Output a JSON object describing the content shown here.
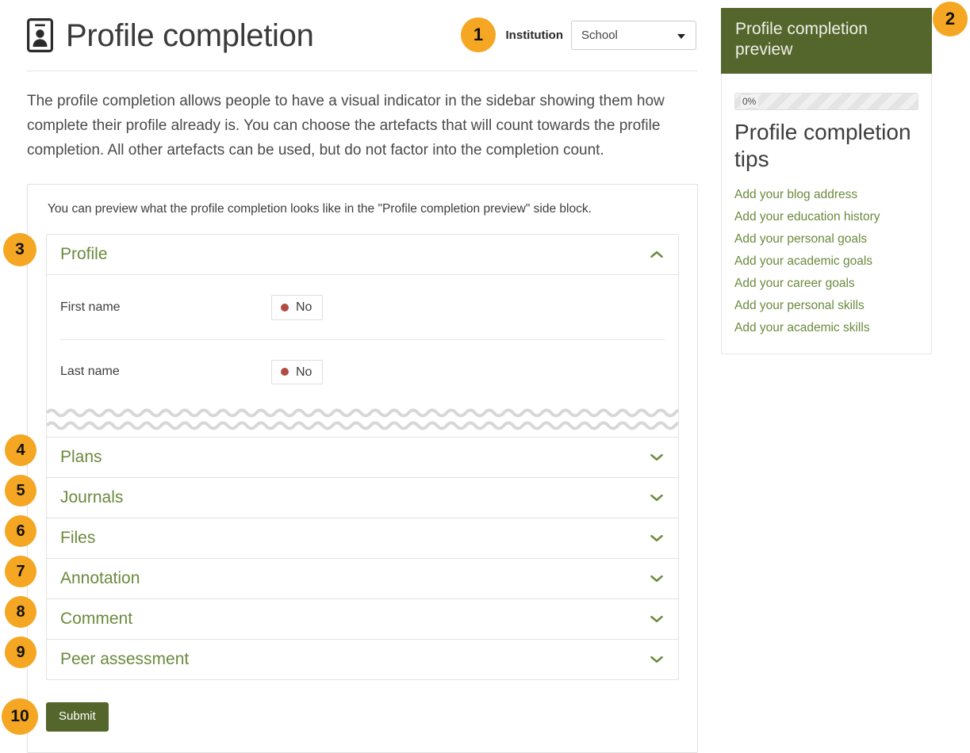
{
  "header": {
    "title": "Profile completion",
    "icon": "id-card-icon",
    "institution_label": "Institution",
    "institution_value": "School",
    "institution_options": [
      "School"
    ]
  },
  "intro": {
    "text": "The profile completion allows people to have a visual indicator in the sidebar showing them how complete their profile already is. You can choose the artefacts that will count towards the profile completion. All other artefacts can be used, but do not factor into the completion count."
  },
  "card": {
    "note": "You can preview what the profile completion looks like in the \"Profile completion preview\" side block.",
    "submit_label": "Submit"
  },
  "accordion": {
    "sections": [
      {
        "label": "Profile",
        "expanded": true,
        "chevron": "chevron-up-icon",
        "fields": [
          {
            "label": "First name",
            "value": "No",
            "state_color": "#b04b45"
          },
          {
            "label": "Last name",
            "value": "No",
            "state_color": "#b04b45"
          }
        ]
      },
      {
        "label": "Plans",
        "expanded": false,
        "chevron": "chevron-down-icon"
      },
      {
        "label": "Journals",
        "expanded": false,
        "chevron": "chevron-down-icon"
      },
      {
        "label": "Files",
        "expanded": false,
        "chevron": "chevron-down-icon"
      },
      {
        "label": "Annotation",
        "expanded": false,
        "chevron": "chevron-down-icon"
      },
      {
        "label": "Comment",
        "expanded": false,
        "chevron": "chevron-down-icon"
      },
      {
        "label": "Peer assessment",
        "expanded": false,
        "chevron": "chevron-down-icon"
      }
    ]
  },
  "side_block": {
    "title": "Profile completion preview",
    "progress_percent": 0,
    "progress_label": "0%",
    "tips_title": "Profile completion tips",
    "tips": [
      "Add your blog address",
      "Add your education history",
      "Add your personal goals",
      "Add your academic goals",
      "Add your career goals",
      "Add your personal skills",
      "Add your academic skills"
    ]
  },
  "step_badges": [
    {
      "number": "1"
    },
    {
      "number": "2"
    },
    {
      "number": "3"
    },
    {
      "number": "4"
    },
    {
      "number": "5"
    },
    {
      "number": "6"
    },
    {
      "number": "7"
    },
    {
      "number": "8"
    },
    {
      "number": "9"
    },
    {
      "number": "10"
    }
  ],
  "colors": {
    "brand_green": "#55662c",
    "link_green": "#6b8a3d",
    "badge_orange": "#f5a623",
    "status_red": "#b04b45"
  }
}
